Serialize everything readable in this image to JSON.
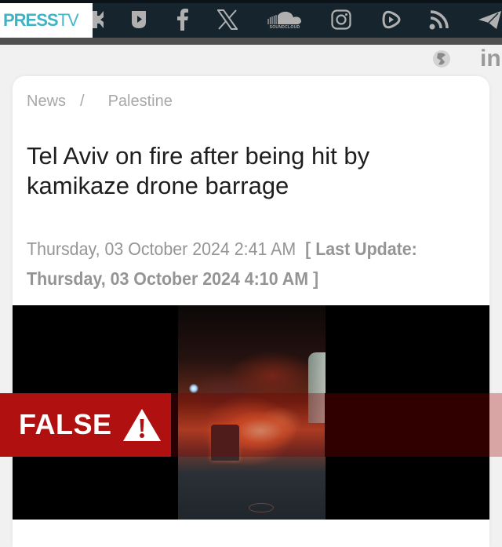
{
  "header": {
    "logo": {
      "part1": "PRESS",
      "part2": "TV"
    },
    "social_icons": [
      "kick-icon",
      "rumble-shield-icon",
      "facebook-icon",
      "x-twitter-icon",
      "soundcloud-icon",
      "instagram-icon",
      "rumble-icon",
      "rss-icon",
      "telegram-icon"
    ],
    "soundcloud_label": "SOUNDCLOUD",
    "secondary_icons": [
      "vk-icon",
      "linkedin-icon"
    ],
    "linkedin_label": "in"
  },
  "article": {
    "breadcrumb": [
      {
        "label": "News"
      },
      {
        "label": "Palestine"
      }
    ],
    "breadcrumb_separator": "/",
    "title": "Tel Aviv on fire after being hit by kamikaze drone barrage",
    "published": "Thursday, 03 October 2024 2:41 AM",
    "update_open": "[",
    "update_label": "Last Update: Thursday, 03 October 2024 4:10 AM",
    "update_close": "]"
  },
  "overlay": {
    "verdict_label": "FALSE",
    "verdict_icon": "warning-triangle-icon",
    "colors": {
      "verdict_red": "#b01010",
      "verdict_dark": "#300000",
      "brand_teal": "#3fb3c4",
      "topbar_bg": "#16242d"
    }
  }
}
